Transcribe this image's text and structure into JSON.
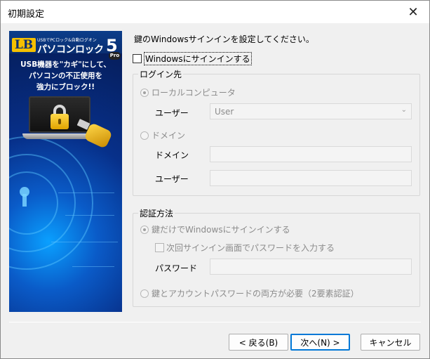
{
  "window": {
    "title": "初期設定",
    "close_glyph": "✕"
  },
  "banner": {
    "logo": "LB",
    "product_sub": "USBでPCロック&自動ログオン",
    "product_name": "パソコンロック",
    "product_version": "5",
    "edition": "Pro",
    "tagline_lines": [
      "USB機器を\"カギ\"にして、",
      "パソコンの不正使用を",
      "強力にブロック!!"
    ]
  },
  "main": {
    "heading": "鍵のWindowsサインインを設定してください。",
    "enable_signin": {
      "label": "Windowsにサインインする",
      "checked": false
    }
  },
  "login_group": {
    "title": "ログイン先",
    "local_radio": {
      "label": "ローカルコンピュータ",
      "checked": true
    },
    "local_user_label": "ユーザー",
    "local_user_value": "User",
    "domain_radio": {
      "label": "ドメイン",
      "checked": false
    },
    "domain_label": "ドメイン",
    "domain_value": "",
    "domain_user_label": "ユーザー",
    "domain_user_value": ""
  },
  "auth_group": {
    "title": "認証方法",
    "key_only_radio": {
      "label": "鍵だけでWindowsにサインインする",
      "checked": true
    },
    "next_signin_checkbox": {
      "label": "次回サインイン画面でパスワードを入力する",
      "checked": false
    },
    "password_label": "パスワード",
    "password_value": "",
    "two_factor_radio": {
      "label": "鍵とアカウントパスワードの両方が必要（2要素認証）",
      "checked": false
    }
  },
  "buttons": {
    "back": "< 戻る(B)",
    "next": "次へ(N) >",
    "cancel": "キャンセル"
  },
  "colors": {
    "window_bg": "#f0f0f0",
    "disabled_text": "#8b8b8b",
    "accent": "#0078d7",
    "banner_dark": "#061a52",
    "banner_light": "#0aa0ff",
    "logo_yellow": "#f5c000"
  },
  "icons": {
    "close": "close-icon",
    "combo_arrow": "chevron-down-icon",
    "lock": "padlock-icon",
    "usb_key": "usb-key-icon",
    "keyhole": "keyhole-icon"
  }
}
